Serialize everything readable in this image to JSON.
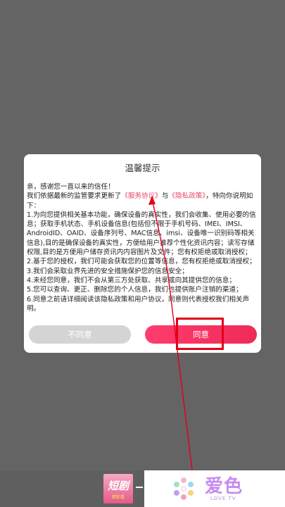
{
  "dialog": {
    "title": "温馨提示",
    "greeting": "亲，感谢您一直以来的信任！",
    "intro_before": "我们依据最新的监管要求更新了",
    "service_link": "《服务协议》",
    "and_text": "与",
    "privacy_link": "《隐私政策》",
    "intro_after": "，特向你说明如下：",
    "items": [
      "1.为向您提供相关基本功能，确保设备的真实性，我们会收集、使用必要的信息；获取手机状态、手机设备信息(包括但不限于手机号码、IMEI、IMSI、AndroidID、OAID、设备序列号、MAC信息、imsi、设备唯一识别码等相关信息),目的是确保设备的真实性，方便给用户推荐个性化资讯内容；读写存储权限,目的是方便用户储存资讯内内容图片及文件；您有权拒绝或取消授权；",
      "2.基于您的授权，我们可能会获取您的位置等信息，您有权拒绝或取消授权；",
      "3.我们会采取业界先进的安全措施保护您的信息安全；",
      "4.未经您同意，我们不会从第三方处获取、共享或向其提供您的信息；",
      "5.您可以查询、更正、删除您的个人信息，我们也提供账户注销的渠道；",
      "6.同意之前请详细阅读该隐私政策和用户协议，同意则代表授权我们相关声明。"
    ],
    "disagree_label": "不同意",
    "agree_label": "同意"
  },
  "bottom": {
    "thumb_title": "短剧",
    "thumb_sub": "精彩看",
    "brand_name": "爱色",
    "brand_sub": "LOVE TV"
  },
  "colors": {
    "accent": "#ee2a58",
    "link": "#e8456b",
    "annotation": "#e0001a",
    "overlay": "#646464"
  }
}
